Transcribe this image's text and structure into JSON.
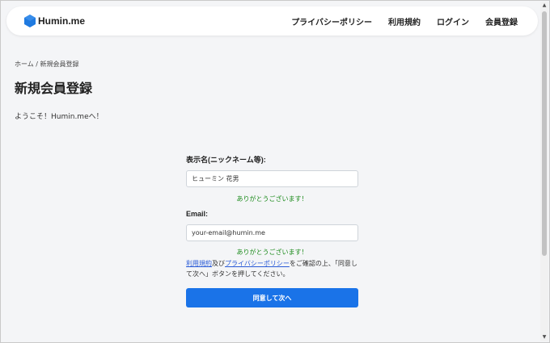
{
  "header": {
    "brand": "Humin.me",
    "brand_color": "#1f7ae0",
    "nav": [
      {
        "label": "プライバシーポリシー"
      },
      {
        "label": "利用規約"
      },
      {
        "label": "ログイン"
      },
      {
        "label": "会員登録"
      }
    ]
  },
  "breadcrumb": "ホーム / 新規会員登録",
  "page": {
    "title": "新規会員登録",
    "welcome": "ようこそ！Humin.meへ！"
  },
  "form": {
    "display_name": {
      "label": "表示名(ニックネーム等):",
      "value": "ヒューミン 花男"
    },
    "display_name_ok": "ありがとうございます！",
    "email": {
      "label": "Email:",
      "value": "your-email@humin.me"
    },
    "email_ok": "ありがとうございます！",
    "terms": {
      "link_terms": "利用規約",
      "and": "及び",
      "link_privacy": "プライバシーポリシー",
      "suffix": "をご確認の上、「同意して次へ」ボタンを押してください。"
    },
    "submit_label": "同意して次へ"
  },
  "colors": {
    "primary": "#1a73e8",
    "success": "#1a8a1a",
    "link": "#2a5bd7"
  },
  "icons": {
    "brand": "hexagon-logo-icon",
    "scroll_up": "arrow-up-icon",
    "scroll_down": "arrow-down-icon"
  }
}
